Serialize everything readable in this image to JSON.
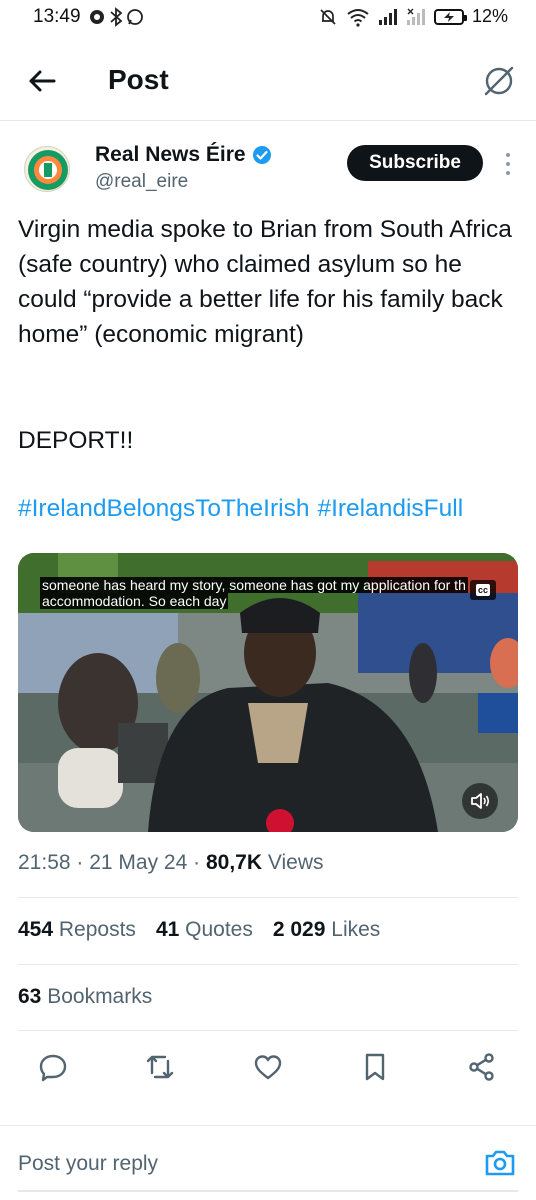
{
  "status_bar": {
    "time": "13:49",
    "battery_text": "12%",
    "icons_left": [
      "notification-icon",
      "bluetooth-icon",
      "whatsapp-icon"
    ],
    "icons_right": [
      "silent-icon",
      "wifi-icon",
      "signal-icon",
      "signal-x-icon",
      "battery-icon"
    ]
  },
  "header": {
    "title": "Post"
  },
  "author": {
    "name": "Real News Éire",
    "handle": "@real_eire",
    "verified": true,
    "subscribe_label": "Subscribe"
  },
  "post": {
    "text": "Virgin media spoke to Brian from South Africa (safe country) who claimed asylum so he could “provide a better life for his family back home” (economic migrant)",
    "deport": "DEPORT!!",
    "hashtags": [
      "#IrelandBelongsToTheIrish",
      "#IrelandisFull"
    ]
  },
  "media": {
    "caption_line1": "someone has heard my story, someone has got my application for th",
    "caption_line2": "accommodation. So each day",
    "cc_label": "cc",
    "sound_icon": "volume-icon"
  },
  "meta": {
    "time": "21:58",
    "date": "21 May 24",
    "views_count": "80,7K",
    "views_label": "Views"
  },
  "stats": {
    "reposts_count": "454",
    "reposts_label": "Reposts",
    "quotes_count": "41",
    "quotes_label": "Quotes",
    "likes_count": "2 029",
    "likes_label": "Likes",
    "bookmarks_count": "63",
    "bookmarks_label": "Bookmarks"
  },
  "actions": [
    "reply-icon",
    "repost-icon",
    "like-icon",
    "bookmark-icon",
    "share-icon"
  ],
  "reply": {
    "placeholder": "Post your reply"
  },
  "colors": {
    "accent": "#1d9bf0",
    "text": "#0f1419",
    "muted": "#536471",
    "divider": "#e6e9ec"
  }
}
